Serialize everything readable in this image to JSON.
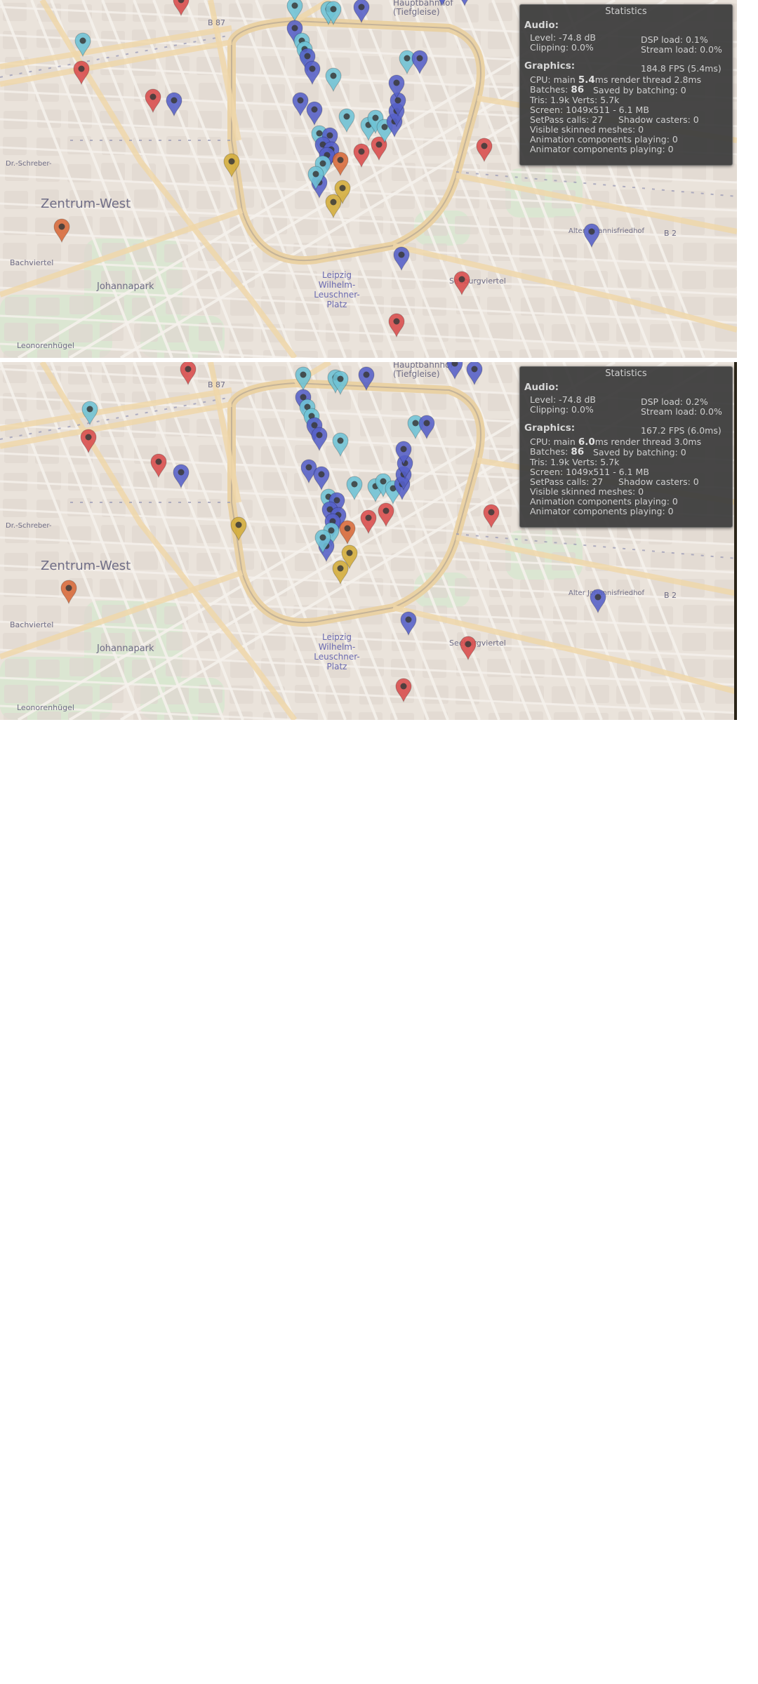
{
  "map": {
    "labels": {
      "zentrum_west": "Zentrum-West",
      "bachviertel": "Bachviertel",
      "johannapark": "Johannapark",
      "leonorenhugel": "Leonorenhügel",
      "leuschner": "Leipzig\nWilhelm-\nLeuschner-\nPlatz",
      "hauptbahnhof": "Hauptbahnhof\n(Tiefgleise)",
      "seeburgviertel": "Seeburgviertel",
      "alter_friedhof": "Alter Johannisfriedhof",
      "b2": "B 2",
      "b87": "B 87",
      "dr_schreber": "Dr.-Schreber-"
    },
    "pin_colors": {
      "red": "#d94c4c",
      "light_blue": "#6ec3d6",
      "blue": "#5560c8",
      "orange": "#d86a3a",
      "yellow": "#d4ad3a"
    }
  },
  "panels": [
    {
      "stats": {
        "title": "Statistics",
        "audio_header": "Audio:",
        "level": "Level: -74.8 dB",
        "clipping": "Clipping: 0.0%",
        "dsp": "DSP load: 0.1%",
        "stream": "Stream load: 0.0%",
        "graphics_header": "Graphics:",
        "fps": "184.8 FPS (5.4ms)",
        "cpu_prefix": "CPU: main ",
        "cpu_main": "5.4",
        "cpu_suffix": "ms  render thread 2.8ms",
        "batches_prefix": "Batches: ",
        "batches": "86",
        "saved": "Saved by batching: 0",
        "tris": "Tris: 1.9k   Verts: 5.7k",
        "screen": "Screen: 1049x511 - 6.1 MB",
        "setpass": "SetPass calls: 27",
        "shadow": "Shadow casters: 0",
        "skinned": "Visible skinned meshes: 0",
        "anim": "Animation components playing: 0",
        "animator": "Animator components playing: 0"
      }
    },
    {
      "stats": {
        "title": "Statistics",
        "audio_header": "Audio:",
        "level": "Level: -74.8 dB",
        "clipping": "Clipping: 0.0%",
        "dsp": "DSP load: 0.2%",
        "stream": "Stream load: 0.0%",
        "graphics_header": "Graphics:",
        "fps": "167.2 FPS (6.0ms)",
        "cpu_prefix": "CPU: main ",
        "cpu_main": "6.0",
        "cpu_suffix": "ms  render thread 3.0ms",
        "batches_prefix": "Batches: ",
        "batches": "86",
        "saved": "Saved by batching: 0",
        "tris": "Tris: 1.9k   Verts: 5.7k",
        "screen": "Screen: 1049x511 - 6.1 MB",
        "setpass": "SetPass calls: 27",
        "shadow": "Shadow casters: 0",
        "skinned": "Visible skinned meshes: 0",
        "anim": "Animation components playing: 0",
        "animator": "Animator components playing: 0"
      }
    }
  ]
}
